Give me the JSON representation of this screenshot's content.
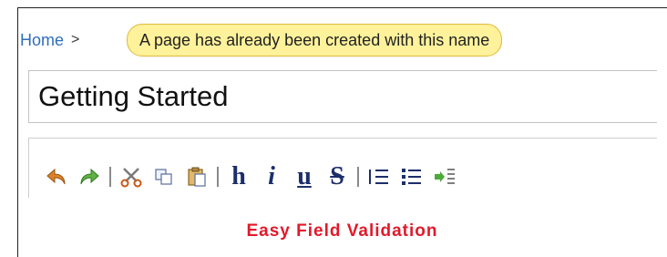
{
  "breadcrumb": {
    "home_label": "Home",
    "separator": ">"
  },
  "validation": {
    "message": "A page has already been created with this name"
  },
  "page_title_field": {
    "value": "Getting Started"
  },
  "toolbar": {
    "buttons": [
      {
        "icon": "undo-icon"
      },
      {
        "icon": "redo-icon"
      },
      {
        "icon": "cut-icon"
      },
      {
        "icon": "copy-icon"
      },
      {
        "icon": "paste-icon"
      },
      {
        "icon": "heading-icon",
        "glyph": "h"
      },
      {
        "icon": "italic-icon",
        "glyph": "i"
      },
      {
        "icon": "underline-icon",
        "glyph": "u"
      },
      {
        "icon": "strikethrough-icon",
        "glyph": "S"
      },
      {
        "icon": "numbered-list-icon"
      },
      {
        "icon": "bulleted-list-icon"
      },
      {
        "icon": "indent-icon"
      }
    ]
  },
  "caption": {
    "text": "Easy Field Validation"
  },
  "colors": {
    "link": "#2f6dbd",
    "badge_fill": "#fff29b",
    "badge_border": "#e2b83a",
    "caption": "#e2192a"
  }
}
